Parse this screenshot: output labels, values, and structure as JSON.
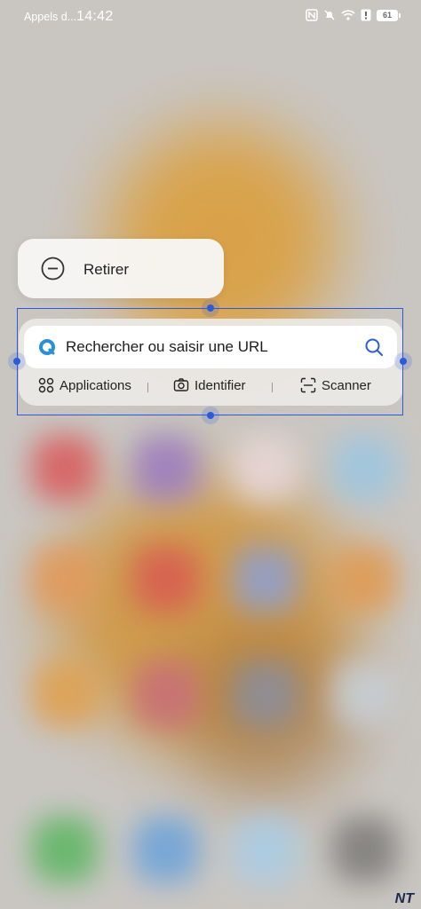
{
  "status_bar": {
    "carrier": "Appels d...",
    "time": "14:42",
    "battery": "61",
    "icons": [
      "nfc-icon",
      "bell-off-icon",
      "wifi-icon",
      "alert-icon",
      "battery-icon"
    ]
  },
  "remove_menu": {
    "label": "Retirer",
    "icon": "minus-circle-icon"
  },
  "widget": {
    "search_placeholder": "Rechercher ou saisir une URL",
    "actions": [
      {
        "label": "Applications",
        "icon": "grid-icon"
      },
      {
        "label": "Identifier",
        "icon": "camera-icon"
      },
      {
        "label": "Scanner",
        "icon": "scan-icon"
      }
    ]
  },
  "watermark": "NT",
  "colors": {
    "selection": "#2c5bd9",
    "search_icon": "#2c5bd9",
    "browser_logo": "#2a8fd6"
  }
}
